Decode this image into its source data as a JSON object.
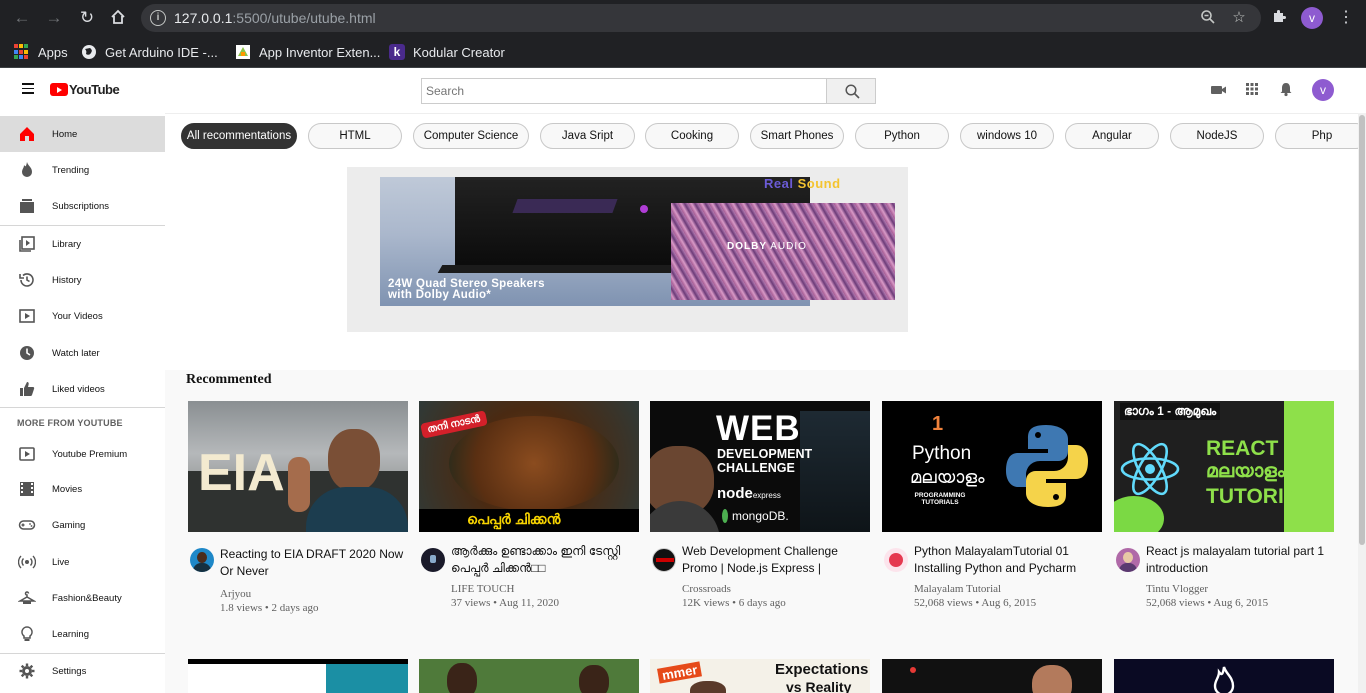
{
  "browser": {
    "url_host": "127.0.0.1",
    "url_rest": ":5500/utube/utube.html",
    "profile_initial": "v",
    "bookmarks": [
      {
        "label": "Apps"
      },
      {
        "label": "Get Arduino IDE -..."
      },
      {
        "label": "App Inventor Exten..."
      },
      {
        "label": "Kodular Creator"
      }
    ]
  },
  "header": {
    "logo_text": "YouTube",
    "search_placeholder": "Search",
    "avatar_initial": "v"
  },
  "sidebar": {
    "items": [
      {
        "label": "Home",
        "icon": "home-icon"
      },
      {
        "label": "Trending",
        "icon": "fire-icon"
      },
      {
        "label": "Subscriptions",
        "icon": "subscriptions-icon"
      },
      {
        "label": "Library",
        "icon": "library-icon"
      },
      {
        "label": "History",
        "icon": "history-icon"
      },
      {
        "label": "Your Videos",
        "icon": "your-videos-icon"
      },
      {
        "label": "Watch later",
        "icon": "clock-icon"
      },
      {
        "label": "Liked videos",
        "icon": "thumbs-up-icon"
      }
    ],
    "more_heading": "MORE FROM YOUTUBE",
    "more_items": [
      {
        "label": "Youtube Premium",
        "icon": "youtube-premium-icon"
      },
      {
        "label": "Movies",
        "icon": "film-icon"
      },
      {
        "label": "Gaming",
        "icon": "gamepad-icon"
      },
      {
        "label": "Live",
        "icon": "live-icon"
      },
      {
        "label": "Fashion&Beauty",
        "icon": "hanger-icon"
      },
      {
        "label": "Learning",
        "icon": "lightbulb-icon"
      }
    ],
    "settings_label": "Settings"
  },
  "chips": [
    "All recommentations",
    "HTML",
    "Computer Science",
    "Java Sript",
    "Cooking",
    "Smart Phones",
    "Python",
    "windows 10",
    "Angular",
    "NodeJS",
    "Php"
  ],
  "ad": {
    "headline_line1": "24W Quad Stereo Speakers",
    "headline_line2": "with Dolby Audio*",
    "brand_real": "Real",
    "brand_sound": "Sound",
    "dolby_bold": "DOLBY",
    "dolby_light": " AUDIO"
  },
  "section_title": "Recommented",
  "videos": [
    {
      "title": "Reacting to EIA DRAFT 2020 Now Or Never",
      "channel": "Arjyou",
      "meta": "1.8 views • 2 days ago",
      "thumb_text": "EIA"
    },
    {
      "title": "ആർക്കും ഉണ്ടാക്കാം ഇനി ടേസ്റ്റി പെപ്പർ ചിക്കൻ□□",
      "channel": "LIFE TOUCH",
      "meta": "37 views • Aug 11, 2020",
      "thumb_text": "പെപ്പർ ചിക്കൻ",
      "thumb_tag": "തനി നാടൻ"
    },
    {
      "title": "Web Development Challenge Promo | Node.js Express |",
      "channel": "Crossroads",
      "meta": "12K views • 6 days ago",
      "thumb_line1": "WEB",
      "thumb_line2": "DEVELOPMENT",
      "thumb_line3": "CHALLENGE",
      "thumb_node": "node",
      "thumb_express": "express",
      "thumb_mongo": "mongoDB."
    },
    {
      "title": "Python MalayalamTutorial 01 Installing Python and Pycharm",
      "channel": "Malayalam Tutorial",
      "meta": "52,068 views • Aug 6, 2015",
      "thumb_num": "1",
      "thumb_python": "Python",
      "thumb_mal": "മലയാളം",
      "thumb_sub": "PROGRAMMING TUTORIALS"
    },
    {
      "title": "React js malayalam tutorial part 1 introduction",
      "channel": "Tintu Vlogger",
      "meta": "52,068 views • Aug 6, 2015",
      "thumb_top": "ഭാഗം 1 - ആമുഖം",
      "thumb_line1": "REACT JS",
      "thumb_line2": "മലയാളം",
      "thumb_line3": "TUTORIAL"
    }
  ],
  "row2": {
    "thumb3_line1": "Expectations",
    "thumb3_line2": "vs Reality",
    "thumb3_tag": "mmer"
  }
}
